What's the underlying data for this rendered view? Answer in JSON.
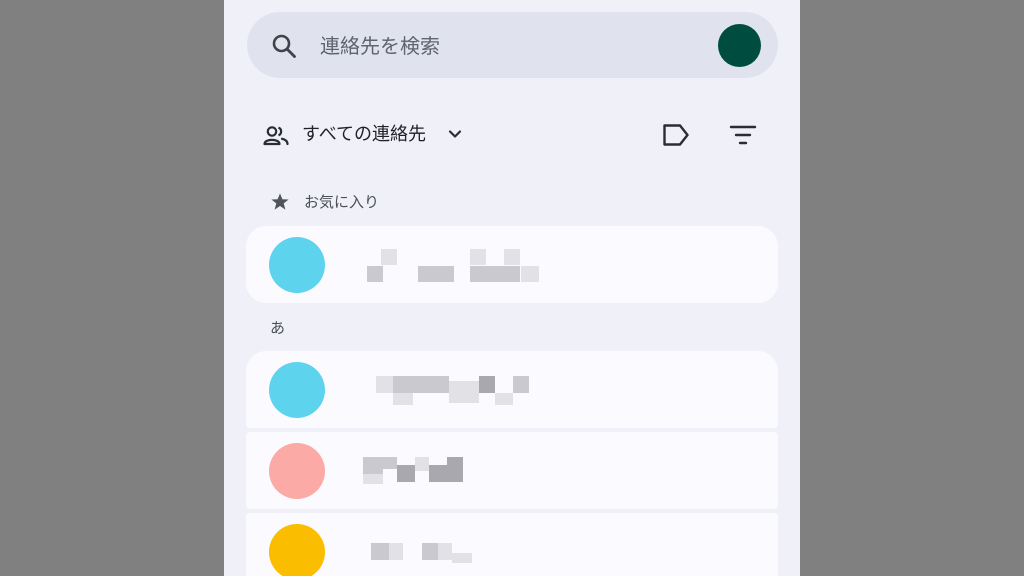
{
  "search": {
    "placeholder": "連絡先を検索",
    "account_avatar_color": "#004d40"
  },
  "toolbar": {
    "filter_label": "すべての連絡先"
  },
  "sections": [
    {
      "header": "お気に入り"
    },
    {
      "header": "あ"
    }
  ],
  "contacts": [
    {
      "avatar_color": "#5dd3ee",
      "name_pixelated": true
    },
    {
      "avatar_color": "#5dd3ee",
      "name_pixelated": true
    },
    {
      "avatar_color": "#fbaaa5",
      "name_pixelated": true
    },
    {
      "avatar_color": "#fbbd00",
      "name_pixelated": true
    }
  ]
}
